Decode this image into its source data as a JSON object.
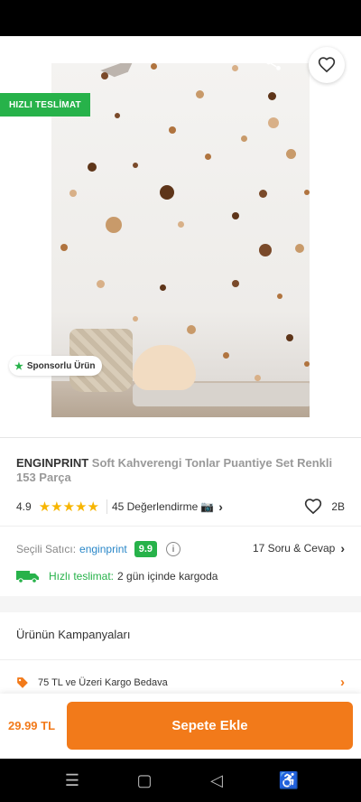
{
  "hero": {
    "fast_badge": "HIZLI TESLİMAT",
    "sponsored_label": "Sponsorlu Ürün",
    "dot_colors": [
      "#7a4a2a",
      "#b0743f",
      "#c89a6a",
      "#d8b088",
      "#5e3519"
    ]
  },
  "product": {
    "brand": "ENGINPRINT",
    "name": "Soft Kahverengi Tonlar Puantiye Set Renkli 153 Parça",
    "rating": "4.9",
    "stars": "★★★★★",
    "reviews_label": "45 Değerlendirme",
    "favorites_count": "2B"
  },
  "seller": {
    "label": "Seçili Satıcı:",
    "name": "enginprint",
    "score": "9.9",
    "qa_label": "17 Soru & Cevap"
  },
  "shipping": {
    "label": "Hızlı teslimat:",
    "text": "2 gün içinde kargoda"
  },
  "campaigns": {
    "title": "Ürünün Kampanyaları",
    "items": [
      {
        "label": "75 TL ve Üzeri Kargo Bedava"
      }
    ]
  },
  "bottom": {
    "price": "29.99 TL",
    "cart_label": "Sepete Ekle"
  },
  "colors": {
    "accent": "#f27a1a",
    "green": "#27b24a",
    "link": "#2a87c8",
    "star": "#f7b500"
  }
}
